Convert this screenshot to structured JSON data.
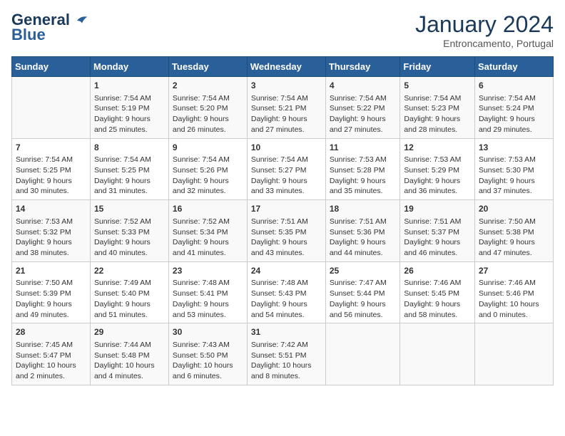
{
  "header": {
    "logo_line1": "General",
    "logo_line2": "Blue",
    "month": "January 2024",
    "location": "Entroncamento, Portugal"
  },
  "weekdays": [
    "Sunday",
    "Monday",
    "Tuesday",
    "Wednesday",
    "Thursday",
    "Friday",
    "Saturday"
  ],
  "weeks": [
    [
      {
        "day": "",
        "info": ""
      },
      {
        "day": "1",
        "info": "Sunrise: 7:54 AM\nSunset: 5:19 PM\nDaylight: 9 hours\nand 25 minutes."
      },
      {
        "day": "2",
        "info": "Sunrise: 7:54 AM\nSunset: 5:20 PM\nDaylight: 9 hours\nand 26 minutes."
      },
      {
        "day": "3",
        "info": "Sunrise: 7:54 AM\nSunset: 5:21 PM\nDaylight: 9 hours\nand 27 minutes."
      },
      {
        "day": "4",
        "info": "Sunrise: 7:54 AM\nSunset: 5:22 PM\nDaylight: 9 hours\nand 27 minutes."
      },
      {
        "day": "5",
        "info": "Sunrise: 7:54 AM\nSunset: 5:23 PM\nDaylight: 9 hours\nand 28 minutes."
      },
      {
        "day": "6",
        "info": "Sunrise: 7:54 AM\nSunset: 5:24 PM\nDaylight: 9 hours\nand 29 minutes."
      }
    ],
    [
      {
        "day": "7",
        "info": "Sunrise: 7:54 AM\nSunset: 5:25 PM\nDaylight: 9 hours\nand 30 minutes."
      },
      {
        "day": "8",
        "info": "Sunrise: 7:54 AM\nSunset: 5:25 PM\nDaylight: 9 hours\nand 31 minutes."
      },
      {
        "day": "9",
        "info": "Sunrise: 7:54 AM\nSunset: 5:26 PM\nDaylight: 9 hours\nand 32 minutes."
      },
      {
        "day": "10",
        "info": "Sunrise: 7:54 AM\nSunset: 5:27 PM\nDaylight: 9 hours\nand 33 minutes."
      },
      {
        "day": "11",
        "info": "Sunrise: 7:53 AM\nSunset: 5:28 PM\nDaylight: 9 hours\nand 35 minutes."
      },
      {
        "day": "12",
        "info": "Sunrise: 7:53 AM\nSunset: 5:29 PM\nDaylight: 9 hours\nand 36 minutes."
      },
      {
        "day": "13",
        "info": "Sunrise: 7:53 AM\nSunset: 5:30 PM\nDaylight: 9 hours\nand 37 minutes."
      }
    ],
    [
      {
        "day": "14",
        "info": "Sunrise: 7:53 AM\nSunset: 5:32 PM\nDaylight: 9 hours\nand 38 minutes."
      },
      {
        "day": "15",
        "info": "Sunrise: 7:52 AM\nSunset: 5:33 PM\nDaylight: 9 hours\nand 40 minutes."
      },
      {
        "day": "16",
        "info": "Sunrise: 7:52 AM\nSunset: 5:34 PM\nDaylight: 9 hours\nand 41 minutes."
      },
      {
        "day": "17",
        "info": "Sunrise: 7:51 AM\nSunset: 5:35 PM\nDaylight: 9 hours\nand 43 minutes."
      },
      {
        "day": "18",
        "info": "Sunrise: 7:51 AM\nSunset: 5:36 PM\nDaylight: 9 hours\nand 44 minutes."
      },
      {
        "day": "19",
        "info": "Sunrise: 7:51 AM\nSunset: 5:37 PM\nDaylight: 9 hours\nand 46 minutes."
      },
      {
        "day": "20",
        "info": "Sunrise: 7:50 AM\nSunset: 5:38 PM\nDaylight: 9 hours\nand 47 minutes."
      }
    ],
    [
      {
        "day": "21",
        "info": "Sunrise: 7:50 AM\nSunset: 5:39 PM\nDaylight: 9 hours\nand 49 minutes."
      },
      {
        "day": "22",
        "info": "Sunrise: 7:49 AM\nSunset: 5:40 PM\nDaylight: 9 hours\nand 51 minutes."
      },
      {
        "day": "23",
        "info": "Sunrise: 7:48 AM\nSunset: 5:41 PM\nDaylight: 9 hours\nand 53 minutes."
      },
      {
        "day": "24",
        "info": "Sunrise: 7:48 AM\nSunset: 5:43 PM\nDaylight: 9 hours\nand 54 minutes."
      },
      {
        "day": "25",
        "info": "Sunrise: 7:47 AM\nSunset: 5:44 PM\nDaylight: 9 hours\nand 56 minutes."
      },
      {
        "day": "26",
        "info": "Sunrise: 7:46 AM\nSunset: 5:45 PM\nDaylight: 9 hours\nand 58 minutes."
      },
      {
        "day": "27",
        "info": "Sunrise: 7:46 AM\nSunset: 5:46 PM\nDaylight: 10 hours\nand 0 minutes."
      }
    ],
    [
      {
        "day": "28",
        "info": "Sunrise: 7:45 AM\nSunset: 5:47 PM\nDaylight: 10 hours\nand 2 minutes."
      },
      {
        "day": "29",
        "info": "Sunrise: 7:44 AM\nSunset: 5:48 PM\nDaylight: 10 hours\nand 4 minutes."
      },
      {
        "day": "30",
        "info": "Sunrise: 7:43 AM\nSunset: 5:50 PM\nDaylight: 10 hours\nand 6 minutes."
      },
      {
        "day": "31",
        "info": "Sunrise: 7:42 AM\nSunset: 5:51 PM\nDaylight: 10 hours\nand 8 minutes."
      },
      {
        "day": "",
        "info": ""
      },
      {
        "day": "",
        "info": ""
      },
      {
        "day": "",
        "info": ""
      }
    ]
  ]
}
